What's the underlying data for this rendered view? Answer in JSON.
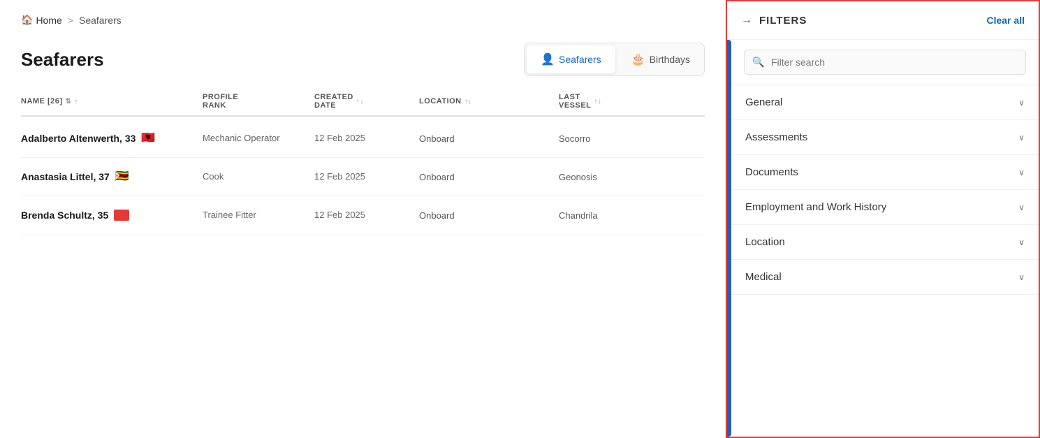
{
  "breadcrumb": {
    "home": "Home",
    "separator": ">",
    "current": "Seafarers"
  },
  "page": {
    "title": "Seafarers"
  },
  "tabs": [
    {
      "id": "seafarers",
      "label": "Seafarers",
      "icon": "👤",
      "active": true
    },
    {
      "id": "birthdays",
      "label": "Birthdays",
      "icon": "🎂",
      "active": false
    }
  ],
  "table": {
    "columns": [
      {
        "id": "name",
        "label": "NAME [26]",
        "sortable": true
      },
      {
        "id": "rank",
        "label": "PROFILE RANK",
        "sortable": false
      },
      {
        "id": "created",
        "label": "CREATED DATE",
        "sortable": true
      },
      {
        "id": "location",
        "label": "LOCATION",
        "sortable": true
      },
      {
        "id": "vessel",
        "label": "LAST VESSEL",
        "sortable": true
      }
    ],
    "rows": [
      {
        "name": "Adalberto Altenwerth, 33",
        "flag": "🇦🇱",
        "rank": "Mechanic Operator",
        "created": "12 Feb 2025",
        "location": "Onboard",
        "vessel": "Socorro"
      },
      {
        "name": "Anastasia Littel, 37",
        "flag": "🇿🇼",
        "rank": "Cook",
        "created": "12 Feb 2025",
        "location": "Onboard",
        "vessel": "Geonosis"
      },
      {
        "name": "Brenda Schultz, 35",
        "flag": "🟥",
        "rank": "Trainee Fitter",
        "created": "12 Feb 2025",
        "location": "Onboard",
        "vessel": "Chandrila"
      }
    ]
  },
  "sidebar": {
    "title": "FILTERS",
    "clear_all": "Clear all",
    "search_placeholder": "Filter search",
    "sections": [
      {
        "id": "general",
        "label": "General"
      },
      {
        "id": "assessments",
        "label": "Assessments"
      },
      {
        "id": "documents",
        "label": "Documents"
      },
      {
        "id": "employment",
        "label": "Employment and Work History"
      },
      {
        "id": "location",
        "label": "Location"
      },
      {
        "id": "medical",
        "label": "Medical"
      }
    ]
  },
  "icons": {
    "home": "🏠",
    "arrow_right": "→",
    "sort_updown": "↑↓",
    "sort_up": "↑",
    "chevron_down": "∨",
    "search": "🔍"
  }
}
